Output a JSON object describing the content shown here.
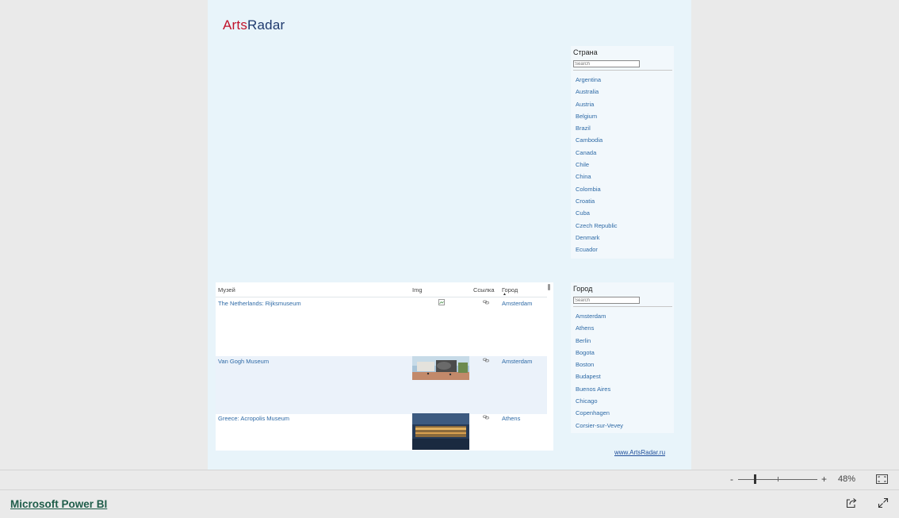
{
  "logo": {
    "part1": "Arts",
    "part2": "Radar"
  },
  "country_slicer": {
    "title": "Страна",
    "search_placeholder": "Search",
    "items": [
      "Argentina",
      "Australia",
      "Austria",
      "Belgium",
      "Brazil",
      "Cambodia",
      "Canada",
      "Chile",
      "China",
      "Colombia",
      "Croatia",
      "Cuba",
      "Czech Republic",
      "Denmark",
      "Ecuador"
    ]
  },
  "city_slicer": {
    "title": "Город",
    "search_placeholder": "Search",
    "items": [
      "Amsterdam",
      "Athens",
      "Berlin",
      "Bogota",
      "Boston",
      "Budapest",
      "Buenos Aires",
      "Chicago",
      "Copenhagen",
      "Corsier-sur-Vevey"
    ]
  },
  "table": {
    "headers": {
      "museum": "Музей",
      "img": "Img",
      "link": "Ссылка",
      "city": "Город"
    },
    "sort_indicator": "▲",
    "rows": [
      {
        "museum": "The Netherlands: Rijksmuseum",
        "city": "Amsterdam",
        "image": "broken-image-icon"
      },
      {
        "museum": "Van Gogh Museum",
        "city": "Amsterdam",
        "image": "museum-thumbnail"
      },
      {
        "museum": "Greece: Acropolis Museum",
        "city": "Athens",
        "image": "museum-thumbnail"
      }
    ]
  },
  "website_link": "www.ArtsRadar.ru",
  "status": {
    "zoom_minus": "-",
    "zoom_plus": "+",
    "zoom_percent": "48%",
    "zoom_level": 0.48
  },
  "footer": {
    "app_link": "Microsoft Power BI"
  },
  "colors": {
    "brand_red": "#c0122b",
    "brand_navy": "#1f3a6e",
    "link_blue": "#2e6aa6",
    "report_bg": "#e8f4fa"
  }
}
